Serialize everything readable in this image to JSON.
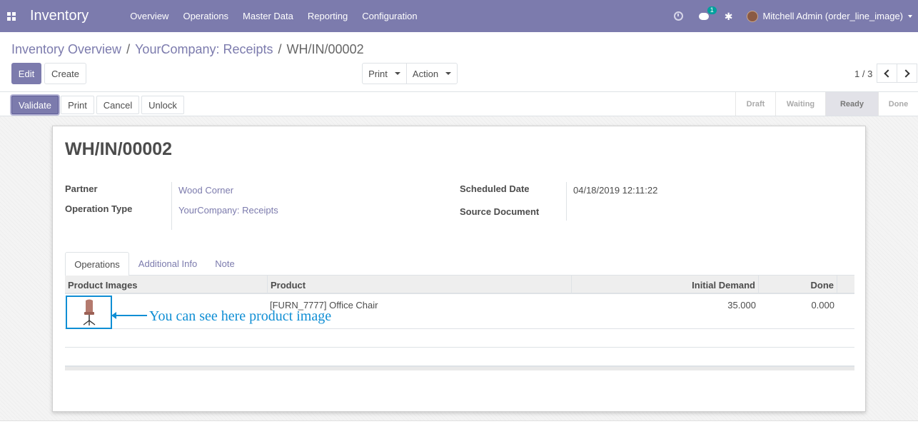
{
  "navbar": {
    "app_title": "Inventory",
    "menu": [
      "Overview",
      "Operations",
      "Master Data",
      "Reporting",
      "Configuration"
    ],
    "messages_count": "1",
    "user": "Mitchell Admin (order_line_image)"
  },
  "breadcrumb": {
    "overview": "Inventory Overview",
    "receipts": "YourCompany: Receipts",
    "current": "WH/IN/00002"
  },
  "toolbar": {
    "edit": "Edit",
    "create": "Create",
    "print": "Print",
    "action": "Action",
    "pager": "1 / 3"
  },
  "statusbar": {
    "buttons": [
      "Validate",
      "Print",
      "Cancel",
      "Unlock"
    ],
    "stages": [
      "Draft",
      "Waiting",
      "Ready",
      "Done"
    ],
    "current_stage": "Ready"
  },
  "record": {
    "name": "WH/IN/00002",
    "partner_label": "Partner",
    "partner": "Wood Corner",
    "operation_type_label": "Operation Type",
    "operation_type": "YourCompany: Receipts",
    "scheduled_date_label": "Scheduled Date",
    "scheduled_date": "04/18/2019 12:11:22",
    "source_document_label": "Source Document"
  },
  "tabs": [
    "Operations",
    "Additional Info",
    "Note"
  ],
  "table": {
    "headers": [
      "Product Images",
      "Product",
      "Initial Demand",
      "Done"
    ],
    "rows": [
      {
        "product": "[FURN_7777] Office Chair",
        "initial_demand": "35.000",
        "done": "0.000"
      }
    ]
  },
  "annotation": "You can see here product image",
  "colors": {
    "brand": "#7c7bad",
    "annotation": "#0f8ed4"
  }
}
